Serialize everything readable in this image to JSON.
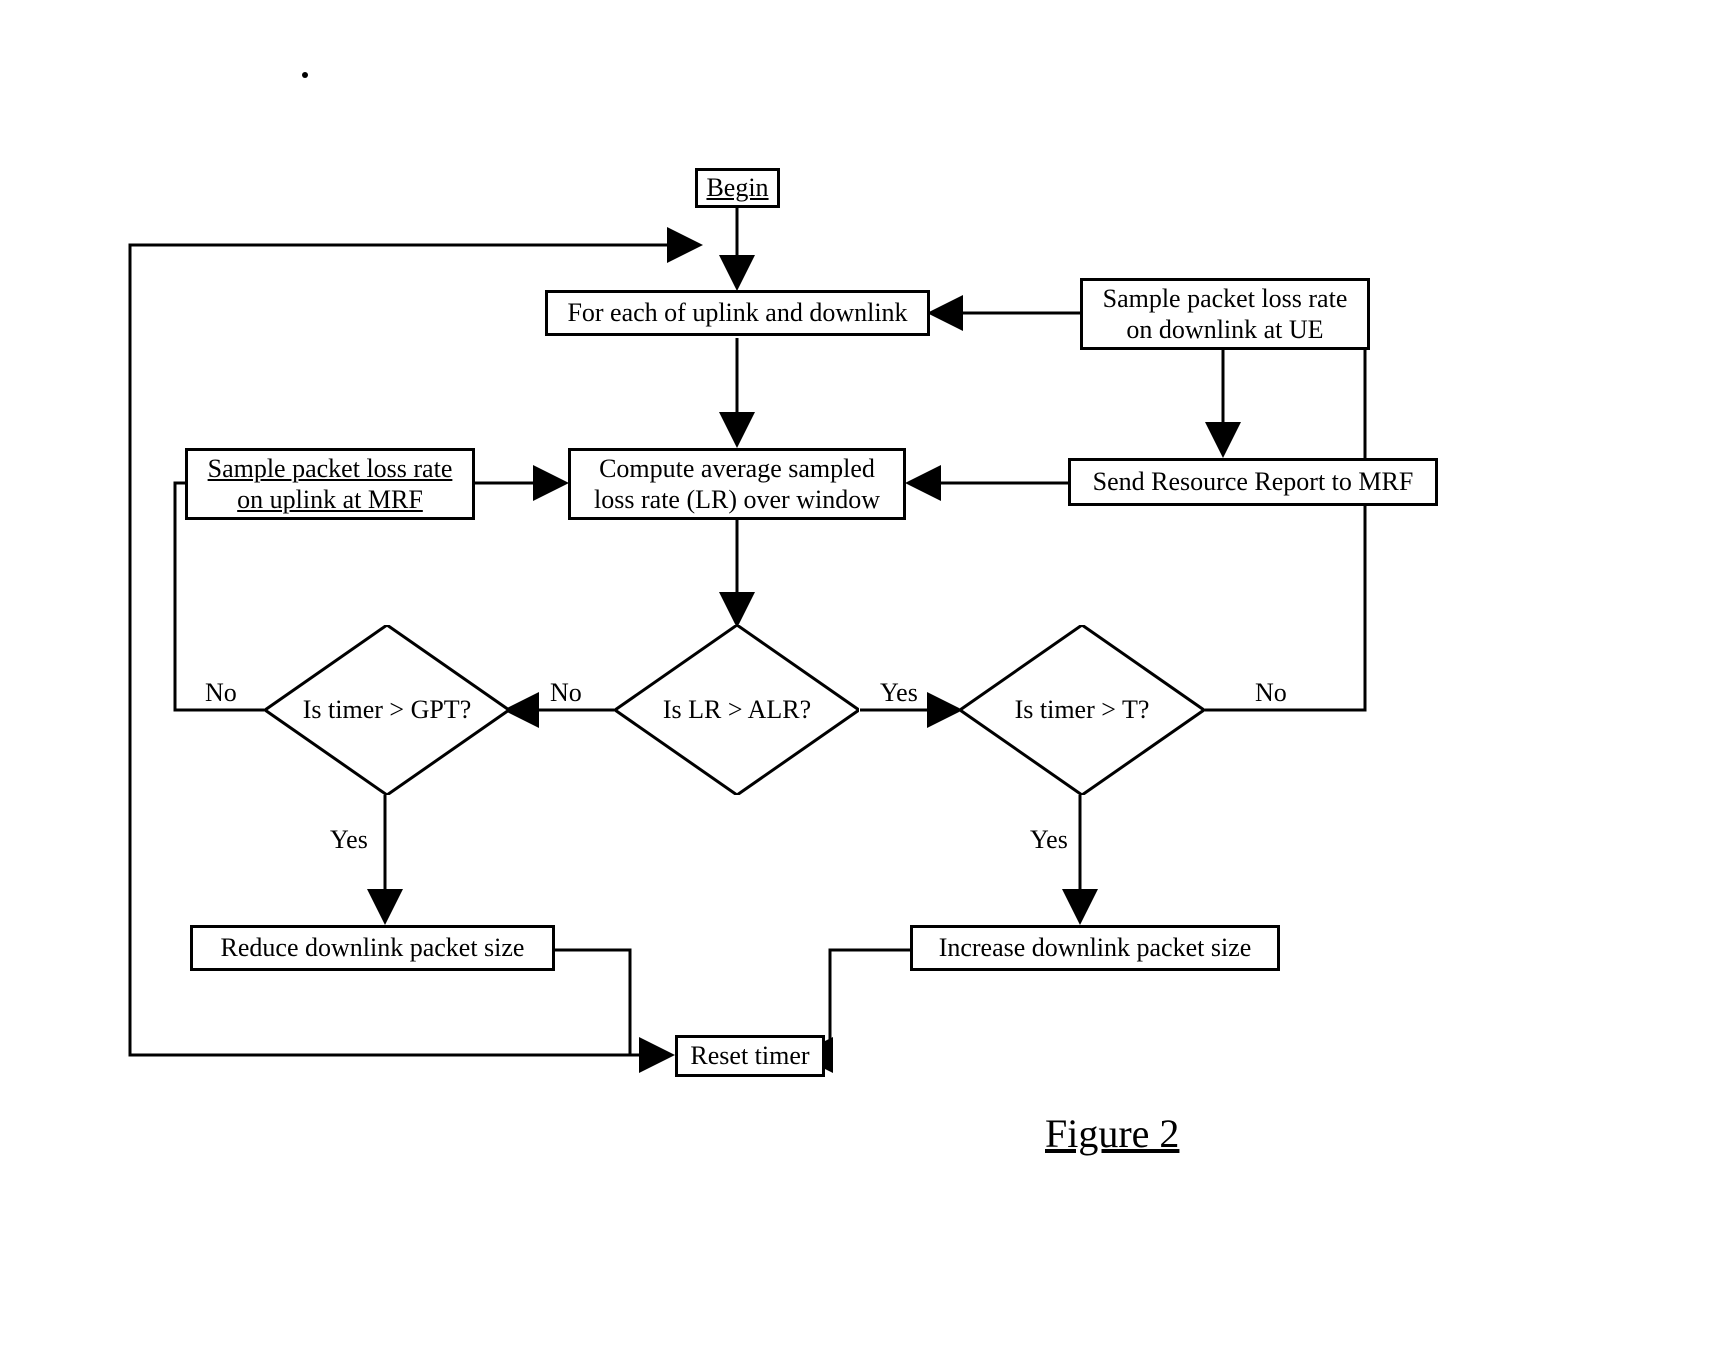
{
  "nodes": {
    "begin": "Begin",
    "for_each": "For each of uplink and downlink",
    "sample_dl_ue": "Sample packet loss rate on downlink at UE",
    "send_report": "Send Resource Report to MRF",
    "sample_ul_mrf": "Sample packet loss rate on uplink at MRF",
    "compute_avg": "Compute average sampled loss rate (LR) over window",
    "dec_gpt": "Is timer > GPT?",
    "dec_alr": "Is LR > ALR?",
    "dec_t": "Is timer > T?",
    "reduce": "Reduce downlink packet size",
    "increase": "Increase downlink packet size",
    "reset": "Reset timer"
  },
  "edge_labels": {
    "no": "No",
    "yes": "Yes"
  },
  "caption": "Figure 2"
}
